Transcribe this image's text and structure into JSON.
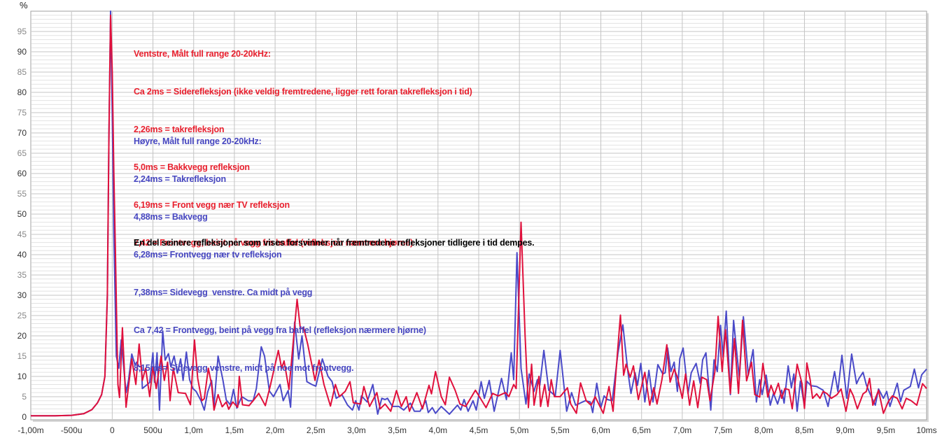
{
  "chart_data": {
    "type": "line",
    "title": "",
    "xlabel": "",
    "ylabel": "%",
    "xlim": [
      -1.0,
      10.0
    ],
    "ylim": [
      -0.7,
      100
    ],
    "grid": true,
    "x_ticks": [
      -1.0,
      -0.5,
      0,
      0.5,
      1.0,
      1.5,
      2.0,
      2.5,
      3.0,
      3.5,
      4.0,
      4.5,
      5.0,
      5.5,
      6.0,
      6.5,
      7.0,
      7.5,
      8.0,
      8.5,
      9.0,
      9.5,
      10.0
    ],
    "x_tick_labels": [
      "-1,00m",
      "-500u",
      "0",
      "500u",
      "1,0m",
      "1,5m",
      "2,0m",
      "2,5m",
      "3,0m",
      "3,5m",
      "4,0m",
      "4,5m",
      "5,0m",
      "5,5m",
      "6,0m",
      "6,5m",
      "7,0m",
      "7,5m",
      "8,0m",
      "8,5m",
      "9,0m",
      "9,5m",
      "10ms"
    ],
    "y_ticks": [
      0,
      5,
      10,
      15,
      20,
      25,
      30,
      35,
      40,
      45,
      50,
      55,
      60,
      65,
      70,
      75,
      80,
      85,
      90,
      95
    ],
    "y_tick_labels": [
      "0",
      "5",
      "10",
      "15",
      "20",
      "25",
      "30",
      "35",
      "40",
      "45",
      "50",
      "55",
      "60",
      "65",
      "70",
      "75",
      "80",
      "85",
      "90",
      "95"
    ],
    "series": [
      {
        "name": "Ventstre",
        "color": "#e0103c",
        "x": [
          -1.0,
          -0.7,
          -0.5,
          -0.35,
          -0.25,
          -0.18,
          -0.13,
          -0.09,
          -0.06,
          -0.04,
          -0.02,
          0.0,
          0.02,
          0.04,
          0.06,
          0.07,
          0.09,
          0.125,
          0.17,
          0.24,
          0.29,
          0.33,
          0.37,
          0.41,
          0.46,
          0.5,
          0.54,
          0.6,
          0.64,
          0.68,
          0.71,
          0.75,
          0.81,
          0.9,
          0.96,
          1.01,
          1.05,
          1.1,
          1.13,
          1.18,
          1.22,
          1.25,
          1.3,
          1.35,
          1.4,
          1.43,
          1.48,
          1.54,
          1.56,
          1.6,
          1.68,
          1.73,
          1.8,
          1.88,
          1.94,
          2.04,
          2.08,
          2.11,
          2.17,
          2.27,
          2.31,
          2.35,
          2.4,
          2.49,
          2.54,
          2.6,
          2.68,
          2.74,
          2.79,
          2.86,
          2.92,
          2.96,
          3.05,
          3.09,
          3.16,
          3.25,
          3.29,
          3.35,
          3.42,
          3.49,
          3.55,
          3.61,
          3.65,
          3.74,
          3.81,
          3.89,
          3.92,
          3.97,
          4.04,
          4.09,
          4.14,
          4.21,
          4.27,
          4.34,
          4.4,
          4.46,
          4.53,
          4.59,
          4.67,
          4.74,
          4.83,
          4.87,
          4.93,
          4.96,
          5.02,
          5.07,
          5.11,
          5.15,
          5.18,
          5.24,
          5.26,
          5.31,
          5.35,
          5.39,
          5.43,
          5.5,
          5.59,
          5.63,
          5.7,
          5.75,
          5.82,
          5.88,
          5.93,
          6.03,
          6.1,
          6.15,
          6.2,
          6.24,
          6.28,
          6.31,
          6.36,
          6.4,
          6.46,
          6.5,
          6.54,
          6.6,
          6.65,
          6.69,
          6.75,
          6.81,
          6.85,
          6.9,
          6.94,
          7.0,
          7.04,
          7.09,
          7.14,
          7.19,
          7.24,
          7.3,
          7.34,
          7.4,
          7.44,
          7.49,
          7.53,
          7.59,
          7.64,
          7.69,
          7.74,
          7.79,
          7.85,
          7.89,
          7.95,
          7.99,
          8.05,
          8.09,
          8.13,
          8.18,
          8.22,
          8.26,
          8.31,
          8.35,
          8.41,
          8.47,
          8.5,
          8.53,
          8.57,
          8.6,
          8.65,
          8.69,
          8.73,
          8.78,
          8.83,
          8.9,
          8.95,
          9.01,
          9.06,
          9.1,
          9.15,
          9.22,
          9.26,
          9.3,
          9.34,
          9.41,
          9.47,
          9.53,
          9.58,
          9.64,
          9.7,
          9.75,
          9.81,
          9.88,
          9.95,
          10.0
        ],
        "y": [
          0.3,
          0.3,
          0.4,
          0.8,
          1.8,
          3.5,
          5.5,
          10,
          30,
          70,
          99,
          85,
          60,
          40,
          18,
          8,
          4.8,
          22,
          2.4,
          14.3,
          8,
          18,
          9,
          12,
          5,
          12.4,
          7,
          15,
          9,
          13.5,
          4,
          12,
          6,
          5.8,
          3,
          19,
          9.5,
          4,
          4.5,
          12,
          8,
          1.7,
          5.5,
          2.5,
          3.7,
          1.9,
          3.7,
          2.4,
          10,
          3,
          2.8,
          4,
          5.8,
          2.8,
          7.6,
          16.4,
          12,
          13.8,
          6.8,
          29,
          21.7,
          22,
          18,
          9,
          14,
          8,
          2.7,
          8,
          5,
          6.3,
          8.7,
          3.5,
          3.2,
          7.5,
          2.6,
          6,
          2,
          3.2,
          1.4,
          6.5,
          2.6,
          5,
          1.4,
          6,
          2,
          7.8,
          5.7,
          11.2,
          5,
          3,
          9.8,
          6.6,
          3.2,
          2.6,
          4.6,
          6.6,
          4.3,
          2.3,
          5.8,
          5.2,
          6,
          5,
          8,
          7,
          48,
          20,
          2.3,
          13,
          2.9,
          10,
          2.6,
          8,
          2.6,
          9.2,
          5,
          5,
          7.2,
          3.2,
          0.9,
          8.4,
          4,
          2.9,
          5,
          0.9,
          7.5,
          1.4,
          14.7,
          25.1,
          10.3,
          13,
          9.8,
          12.6,
          4.3,
          7.5,
          11,
          2.9,
          7.2,
          3.2,
          9.2,
          17.8,
          8.6,
          11.8,
          9.8,
          4.6,
          10.6,
          2.9,
          8.9,
          2.3,
          9.8,
          9.2,
          4,
          11.2,
          24.8,
          11.2,
          21.5,
          5.8,
          19.3,
          5.8,
          23.8,
          8.9,
          13.5,
          5.5,
          4.9,
          13.2,
          4.9,
          7.8,
          5.5,
          8.3,
          4.6,
          7,
          6.7,
          2,
          13,
          8.2,
          2.1,
          13.3,
          9.2,
          4.6,
          5.7,
          4.6,
          6.3,
          5.7,
          4.6,
          5.5,
          6.9,
          1.4,
          6.9,
          5.2,
          2,
          5.7,
          6.3,
          9.5,
          2.9,
          6.6,
          0.9,
          3.8,
          5.2,
          4.6,
          2,
          4.6,
          4,
          2.9,
          8.2,
          7
        ]
      },
      {
        "name": "Høyre",
        "color": "#4a4ac8",
        "x": [
          -1.0,
          -0.7,
          -0.5,
          -0.35,
          -0.25,
          -0.18,
          -0.13,
          -0.09,
          -0.06,
          -0.04,
          -0.02,
          0.0,
          0.02,
          0.05,
          0.08,
          0.11,
          0.17,
          0.2,
          0.24,
          0.28,
          0.3,
          0.33,
          0.36,
          0.37,
          0.43,
          0.46,
          0.5,
          0.52,
          0.55,
          0.58,
          0.62,
          0.65,
          0.69,
          0.72,
          0.76,
          0.8,
          0.84,
          0.87,
          0.91,
          0.95,
          0.99,
          1.03,
          1.09,
          1.13,
          1.17,
          1.22,
          1.25,
          1.3,
          1.36,
          1.4,
          1.45,
          1.49,
          1.53,
          1.59,
          1.67,
          1.73,
          1.77,
          1.83,
          1.87,
          1.93,
          1.98,
          2.06,
          2.1,
          2.16,
          2.19,
          2.24,
          2.29,
          2.33,
          2.39,
          2.45,
          2.5,
          2.58,
          2.65,
          2.7,
          2.75,
          2.82,
          2.89,
          2.95,
          2.99,
          3.03,
          3.06,
          3.13,
          3.2,
          3.26,
          3.31,
          3.35,
          3.38,
          3.44,
          3.52,
          3.58,
          3.66,
          3.71,
          3.78,
          3.85,
          3.88,
          3.93,
          3.97,
          4.04,
          4.14,
          4.24,
          4.28,
          4.32,
          4.37,
          4.43,
          4.47,
          4.53,
          4.57,
          4.63,
          4.69,
          4.78,
          4.84,
          4.9,
          4.93,
          4.97,
          5.02,
          5.08,
          5.12,
          5.18,
          5.22,
          5.25,
          5.3,
          5.36,
          5.44,
          5.5,
          5.58,
          5.64,
          5.69,
          5.81,
          5.87,
          5.9,
          5.95,
          6.0,
          6.04,
          6.08,
          6.14,
          6.21,
          6.27,
          6.33,
          6.37,
          6.42,
          6.45,
          6.49,
          6.54,
          6.59,
          6.64,
          6.7,
          6.76,
          6.79,
          6.82,
          6.86,
          6.9,
          6.94,
          6.97,
          7.01,
          7.07,
          7.11,
          7.17,
          7.22,
          7.25,
          7.29,
          7.35,
          7.39,
          7.43,
          7.47,
          7.5,
          7.54,
          7.59,
          7.63,
          7.7,
          7.75,
          7.81,
          7.87,
          7.91,
          7.95,
          7.98,
          8.03,
          8.08,
          8.12,
          8.17,
          8.22,
          8.25,
          8.3,
          8.34,
          8.37,
          8.41,
          8.45,
          8.5,
          8.53,
          8.58,
          8.65,
          8.73,
          8.79,
          8.87,
          8.91,
          8.96,
          9.02,
          9.08,
          9.14,
          9.17,
          9.22,
          9.26,
          9.33,
          9.37,
          9.41,
          9.47,
          9.51,
          9.55,
          9.64,
          9.68,
          9.72,
          9.8,
          9.85,
          9.9,
          9.94,
          10.0
        ],
        "y": [
          0.3,
          0.3,
          0.4,
          0.8,
          1.8,
          3.5,
          5.5,
          10,
          30,
          70,
          100,
          75,
          45,
          15,
          12,
          19,
          6,
          9,
          15.5,
          12.8,
          13.5,
          12.4,
          12.4,
          7,
          8,
          8.5,
          15.8,
          8.5,
          15.8,
          1.7,
          21.2,
          14,
          15.6,
          12.4,
          15,
          10.8,
          14.3,
          9,
          16,
          9.2,
          7,
          6.3,
          4,
          1.7,
          6,
          9,
          2.8,
          15,
          9,
          4.2,
          3,
          6.8,
          2.2,
          5,
          4,
          4,
          7,
          17.3,
          15,
          6.4,
          5,
          8,
          4,
          6.5,
          2.4,
          23.4,
          14.3,
          20,
          8.7,
          8,
          7.6,
          14.3,
          10,
          8.7,
          4.6,
          5.5,
          2.9,
          1.7,
          4,
          1.7,
          5.2,
          3.7,
          8,
          0.7,
          4.6,
          4.3,
          4.6,
          2.6,
          2.6,
          1.7,
          3.4,
          1.4,
          1.4,
          4,
          1.1,
          2.3,
          0.9,
          2.6,
          0.7,
          2.9,
          1.7,
          4.3,
          1.4,
          4,
          1.7,
          8.7,
          4.6,
          9,
          1.4,
          9.5,
          4.3,
          15.8,
          9.2,
          40.5,
          12,
          3.2,
          10.6,
          6.3,
          9.2,
          7.8,
          16.4,
          6.6,
          5.2,
          16.4,
          1.4,
          6,
          2.9,
          4,
          3.7,
          1.1,
          8.3,
          2.3,
          5.2,
          4.3,
          4,
          15.8,
          22.7,
          11.5,
          5.8,
          10.9,
          7.8,
          13.2,
          3.7,
          11.5,
          3.7,
          12.9,
          10.6,
          10.9,
          17,
          11.2,
          13.5,
          6.3,
          14.4,
          17,
          5.8,
          10.9,
          13.2,
          8.3,
          14.1,
          15.8,
          1.7,
          14.1,
          11.2,
          22.6,
          14.7,
          26.1,
          5.5,
          23.8,
          9.5,
          24.7,
          10.3,
          16.6,
          3.7,
          9.2,
          5.5,
          10.3,
          2.9,
          5.8,
          3.2,
          6.6,
          3.4,
          12.6,
          7.2,
          10.6,
          1.4,
          8.8,
          2.6,
          8.8,
          7.7,
          7.5,
          6.6,
          2.6,
          11.2,
          6.3,
          15.2,
          4.6,
          15.5,
          8.2,
          9.5,
          11,
          7.9,
          4.6,
          2.9,
          6.9,
          4.6,
          6.3,
          2.6,
          8.3,
          3.8,
          6.6,
          7.5,
          11.8,
          7.2,
          10.4,
          11.8
        ]
      }
    ],
    "annotations": {
      "red": [
        "Ventstre, Målt full range 20-20kHz:",
        "Ca 2ms = Siderefleksjon (ikke veldig fremtredene, ligger rett foran takrefleksjon i tid)",
        "2,26ms = takrefleksjon",
        "5,0ms = Bakkvegg refleksjon",
        "6,19ms = Front vegg nær TV refleksjon",
        "7,42 = Frontvegg, beint på vegg fra baffel (refleksjon nærmere hjørne)"
      ],
      "blue": [
        "Høyre, Målt full range 20-20kHz:",
        "2,24ms = Takrefleksjon",
        "4,88ms = Bakvegg",
        "6,28ms= Frontvegg nær tv refleksjon",
        "7,38ms= Sidevegg  venstre. Ca midt på vegg",
        "Ca 7,42 = Frontvegg, beint på vegg fra baffel (refleksjon nærmere hjørne)",
        "8,15ms= Sidevegg venstre, midt på noe mot frontvegg."
      ],
      "black": [
        "En del seinere refleksjoner som vises forsvinner når fremtredene refleksjoner tidligere i tid dempes."
      ]
    }
  }
}
